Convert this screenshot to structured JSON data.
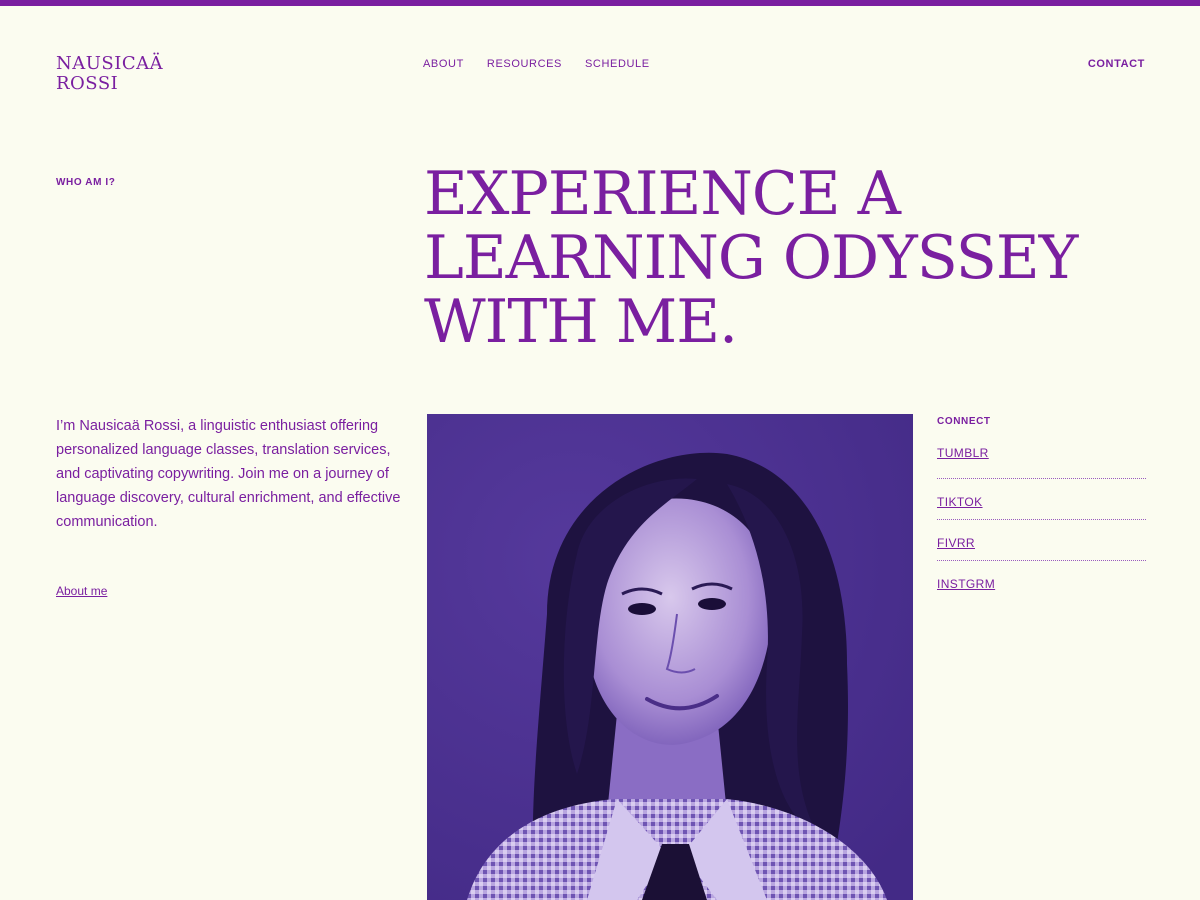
{
  "brand": {
    "line1": "NAUSICAÄ",
    "line2": "ROSSI"
  },
  "nav": {
    "items": [
      {
        "label": "ABOUT"
      },
      {
        "label": "RESOURCES"
      },
      {
        "label": "SCHEDULE"
      }
    ],
    "contact_label": "CONTACT"
  },
  "hero": {
    "section_label": "WHO AM I?",
    "headline_lines": [
      "EXPERIENCE A",
      "LEARNING ODYSSEY",
      "WITH ME."
    ]
  },
  "intro": {
    "bio": "I’m Nausicaä Rossi, a linguistic enthusiast offering personalized language classes, translation services, and captivating copywriting. Join me on a journey of language discovery, cultural enrichment, and effective communication.",
    "about_link": "About me"
  },
  "connect": {
    "label": "CONNECT",
    "links": [
      {
        "label": "TUMBLR"
      },
      {
        "label": "TIKTOK"
      },
      {
        "label": "FIVRR"
      },
      {
        "label": "INSTGRM"
      }
    ]
  },
  "colors": {
    "accent": "#7a1fa0",
    "background": "#fbfcf0",
    "photo_tint": "#4b2f93"
  }
}
